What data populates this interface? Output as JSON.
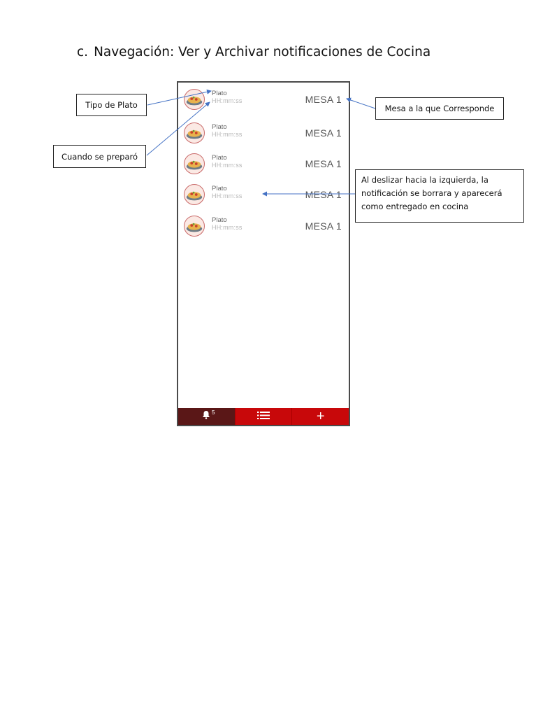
{
  "section": {
    "marker": "c.",
    "title": "Navegación: Ver y Archivar notificaciones de Cocina"
  },
  "phone": {
    "notifications": [
      {
        "dish": "Plato",
        "time": "HH:mm:ss",
        "table": "MESA 1"
      },
      {
        "dish": "Plato",
        "time": "HH:mm:ss",
        "table": "MESA 1"
      },
      {
        "dish": "Plato",
        "time": "HH:mm:ss",
        "table": "MESA 1"
      },
      {
        "dish": "Plato",
        "time": "HH:mm:ss",
        "table": "MESA 1"
      },
      {
        "dish": "Plato",
        "time": "HH:mm:ss",
        "table": "MESA 1"
      }
    ],
    "bottom_bar": {
      "bell_icon": "bell-icon",
      "badge_count": "5",
      "list_icon": "list-icon",
      "add_label": "+"
    },
    "colors": {
      "bell_tab": "#5a1717",
      "tabs": "#c8080a"
    }
  },
  "callouts": {
    "tipo_plato": "Tipo de Plato",
    "cuando_preparo": "Cuando se preparó",
    "mesa": "Mesa a la que Corresponde",
    "deslizar": [
      "Al deslizar hacia la izquierda, la",
      "notificación se borrara y aparecerá",
      "como entregado en cocina"
    ]
  }
}
